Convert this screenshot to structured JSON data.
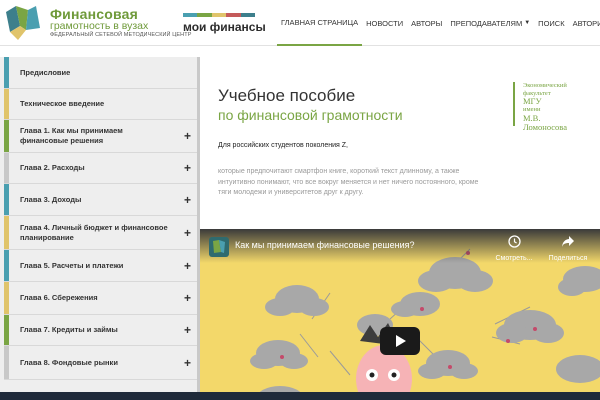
{
  "header": {
    "logo_line1": "Финансовая",
    "logo_line2": "грамотность в вузах",
    "logo_line3": "ФЕДЕРАЛЬНЫЙ СЕТЕВОЙ МЕТОДИЧЕСКИЙ ЦЕНТР",
    "brand_title": "мои финансы",
    "nav": [
      {
        "label": "ГЛАВНАЯ СТРАНИЦА",
        "active": true
      },
      {
        "label": "НОВОСТИ"
      },
      {
        "label": "АВТОРЫ"
      },
      {
        "label": "ПРЕПОДАВАТЕЛЯМ",
        "dropdown": true
      },
      {
        "label": "ПОИСК"
      },
      {
        "label": "АВТОРИЗАЦИЯ"
      }
    ]
  },
  "sidebar": {
    "items": [
      {
        "label": "Предисловие",
        "accent": "#4a9fb0",
        "expandable": false
      },
      {
        "label": "Техническое введение",
        "accent": "#e0c46b",
        "expandable": false
      },
      {
        "label": "Глава 1. Как мы принимаем финансовые решения",
        "accent": "#7aa544",
        "expandable": true,
        "plus": "+"
      },
      {
        "label": "Глава 2. Расходы",
        "accent": "#c8c8c8",
        "expandable": true,
        "plus": "+"
      },
      {
        "label": "Глава 3. Доходы",
        "accent": "#4a9fb0",
        "expandable": true,
        "plus": "+"
      },
      {
        "label": "Глава 4. Личный бюджет и финансовое планирование",
        "accent": "#e0c46b",
        "expandable": true,
        "plus": "+"
      },
      {
        "label": "Глава 5. Расчеты и платежи",
        "accent": "#4a9fb0",
        "expandable": true,
        "plus": "+"
      },
      {
        "label": "Глава 6. Сбережения",
        "accent": "#e0c46b",
        "expandable": true,
        "plus": "+"
      },
      {
        "label": "Глава 7. Кредиты и займы",
        "accent": "#7aa544",
        "expandable": true,
        "plus": "+"
      },
      {
        "label": "Глава 8. Фондовые рынки",
        "accent": "#c8c8c8",
        "expandable": true,
        "plus": "+"
      }
    ]
  },
  "main": {
    "title": "Учебное пособие",
    "subtitle": "по финансовой грамотности",
    "badge": {
      "line1": "Экономический",
      "line2": "факультет",
      "line3": "МГУ",
      "line4": "имени",
      "line5": "М.В. Ломоносова"
    },
    "intro": "Для российских студентов поколения Z,",
    "paragraph": "которые предпочитают смартфон книге, короткий текст длинному, а также интуитивно понимают, что все вокруг меняется и нет ничего постоянного, кроме тяги молодежи и университетов друг к другу."
  },
  "video": {
    "title": "Как мы принимаем финансовые решения?",
    "watch_later_label": "Смотреть...",
    "share_label": "Поделиться"
  },
  "colors": {
    "brand_green": "#7aa544",
    "video_bg": "#f3d86a",
    "taskbar": "#1f2a3a"
  }
}
